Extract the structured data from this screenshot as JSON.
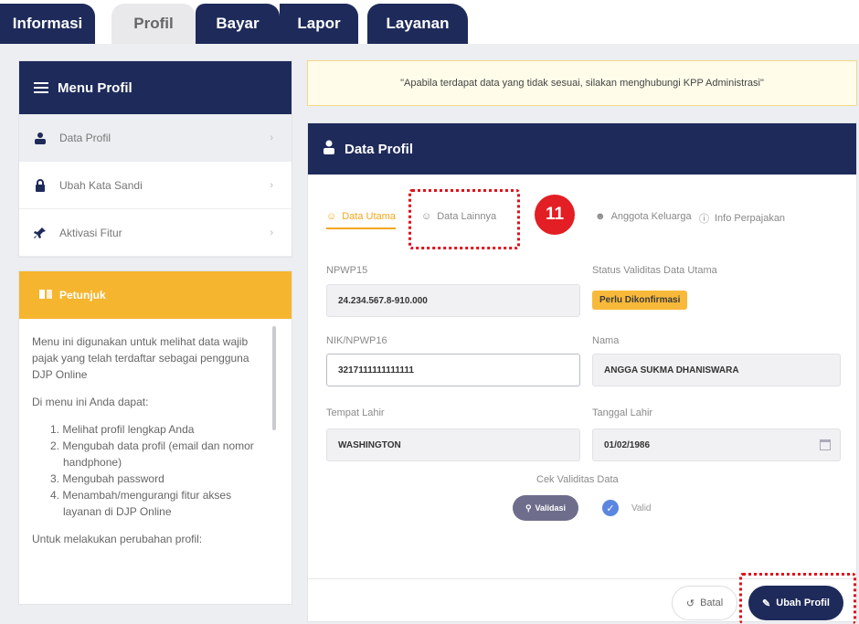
{
  "tabs": [
    {
      "label": "Informasi",
      "active": false
    },
    {
      "label": "Profil",
      "active": true
    },
    {
      "label": "Bayar",
      "active": false
    },
    {
      "label": "Lapor",
      "active": false
    },
    {
      "label": "Layanan",
      "active": false
    }
  ],
  "menu": {
    "title": "Menu Profil",
    "items": [
      {
        "label": "Data Profil",
        "icon": "user-icon"
      },
      {
        "label": "Ubah Kata Sandi",
        "icon": "lock-icon"
      },
      {
        "label": "Aktivasi Fitur",
        "icon": "pin-icon"
      }
    ]
  },
  "help": {
    "title": "Petunjuk",
    "intro": "Menu ini digunakan untuk melihat data wajib pajak yang telah terdaftar sebagai pengguna DJP Online",
    "can_do": "Di menu ini Anda dapat:",
    "steps": [
      "1. Melihat profil lengkap Anda",
      "2. Mengubah data profil (email dan nomor handphone)",
      "3. Mengubah password",
      "4. Menambah/mengurangi fitur akses layanan di DJP Online"
    ],
    "footer": "Untuk melakukan perubahan profil:"
  },
  "notice": "\"Apabila terdapat data yang tidak sesuai, silakan menghubungi KPP Administrasi\"",
  "profile": {
    "title": "Data Profil",
    "subtabs": [
      "Data Utama",
      "Data Lainnya",
      "Anggota Keluarga",
      "Info Perpajakan"
    ],
    "step_number": "11",
    "fields": {
      "npwp15_label": "NPWP15",
      "npwp15_value": "24.234.567.8-910.000",
      "status_label": "Status Validitas Data Utama",
      "status_value": "Perlu Dikonfirmasi",
      "nik_label": "NIK/NPWP16",
      "nik_value": "3217111111111111",
      "nama_label": "Nama",
      "nama_value": "ANGGA SUKMA DHANISWARA",
      "tempat_label": "Tempat Lahir",
      "tempat_value": "WASHINGTON",
      "tanggal_label": "Tanggal Lahir",
      "tanggal_value": "01/02/1986"
    },
    "cek_label": "Cek Validitas Data",
    "validasi_button": "Validasi",
    "valid_label": "Valid",
    "batal_button": "Batal",
    "ubah_button": "Ubah Profil"
  },
  "colors": {
    "navy": "#1e2a5a",
    "orange": "#f6b52f",
    "red": "#e31e24"
  }
}
